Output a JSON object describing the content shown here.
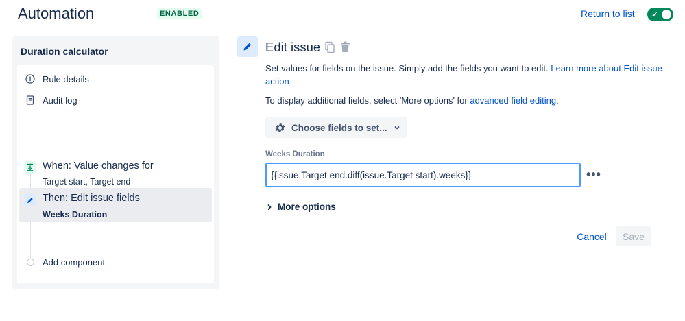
{
  "header": {
    "title": "Automation",
    "status_badge": "ENABLED",
    "return_link": "Return to list",
    "toggle_on": true
  },
  "sidebar": {
    "title": "Duration calculator",
    "menu": [
      {
        "label": "Rule details",
        "icon": "info-icon"
      },
      {
        "label": "Audit log",
        "icon": "document-icon"
      }
    ],
    "steps": [
      {
        "title": "When: Value changes for",
        "subtitle": "Target start, Target end",
        "icon": "trigger-icon",
        "selected": false
      },
      {
        "title": "Then: Edit issue fields",
        "subtitle": "Weeks Duration",
        "icon": "pencil-icon",
        "selected": true
      }
    ],
    "add_component": "Add component"
  },
  "editor": {
    "title": "Edit issue",
    "description_text": "Set values for fields on the issue. Simply add the fields you want to edit. ",
    "learn_more_link": "Learn more about Edit issue action",
    "display_text": "To display additional fields, select 'More options' for ",
    "advanced_link": "advanced field editing",
    "display_suffix": ".",
    "choose_fields_label": "Choose fields to set...",
    "field": {
      "label": "Weeks Duration",
      "value": "{{issue.Target end.diff(issue.Target start).weeks}}"
    },
    "more_options_label": "More options",
    "cancel_label": "Cancel",
    "save_label": "Save"
  },
  "colors": {
    "accent": "#0052cc",
    "toggle": "#00875a",
    "badge_bg": "#e3fcef",
    "badge_text": "#006644"
  }
}
